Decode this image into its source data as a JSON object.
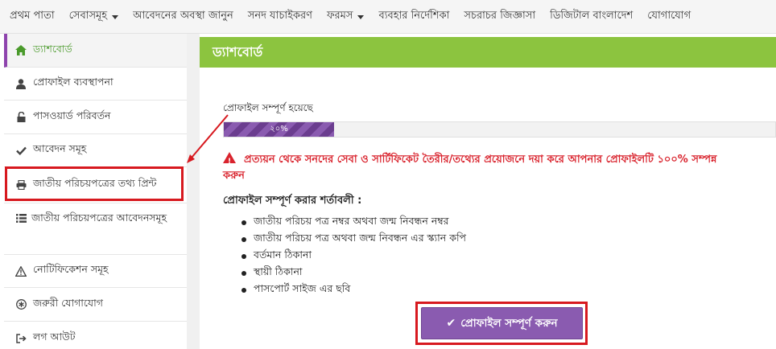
{
  "topnav": {
    "items": [
      {
        "label": "প্রথম পাতা",
        "dropdown": false
      },
      {
        "label": "সেবাসমূহ",
        "dropdown": true
      },
      {
        "label": "আবেদনের অবস্থা জানুন",
        "dropdown": false
      },
      {
        "label": "সনদ যাচাইকরণ",
        "dropdown": false
      },
      {
        "label": "ফরমস",
        "dropdown": true
      },
      {
        "label": "ব্যবহার নির্দেশিকা",
        "dropdown": false
      },
      {
        "label": "সচরাচর জিজ্ঞাসা",
        "dropdown": false
      },
      {
        "label": "ডিজিটাল বাংলাদেশ",
        "dropdown": false
      },
      {
        "label": "যোগাযোগ",
        "dropdown": false
      }
    ]
  },
  "sidebar": {
    "items": [
      {
        "label": "ড্যাশবোর্ড",
        "icon": "home-icon"
      },
      {
        "label": "প্রোফাইল ব্যবস্থাপনা",
        "icon": "user-icon"
      },
      {
        "label": "পাসওয়ার্ড পরিবর্তন",
        "icon": "lock-icon"
      },
      {
        "label": "আবেদন সমূহ",
        "icon": "check-icon"
      },
      {
        "label": "জাতীয় পরিচয়পত্রের তথ্য প্রিন্ট",
        "icon": "print-icon"
      },
      {
        "label": "জাতীয় পরিচয়পত্রের আবেদনসমূহ",
        "icon": "list-icon"
      },
      {
        "label": "নোটিফিকেশন সমূহ",
        "icon": "warning-icon"
      },
      {
        "label": "জরুরী যোগাযোগ",
        "icon": "asterisk-icon"
      },
      {
        "label": "লগ আউট",
        "icon": "logout-icon"
      }
    ]
  },
  "main": {
    "header": "ড্যাশবোর্ড",
    "progress": {
      "label": "প্রোফাইল সম্পূর্ণ হয়েছে",
      "percent": 20,
      "text": "২০%"
    },
    "warning": {
      "line1": "প্রত্যয়ন থেকে সনদের সেবা ও সার্টিফিকেট তৈরীর/তথ্যের প্রয়োজনে দয়া করে আপনার প্রোফাইলটি ১০০% সম্পন্ন",
      "line2": "করুন"
    },
    "conditions_title": "প্রোফাইল সম্পূর্ণ করার শর্তাবলী :",
    "conditions": [
      "জাতীয় পরিচয় পত্র নম্বর অথবা জন্ম নিবন্ধন নম্বর",
      "জাতীয় পরিচয় পত্র অথবা জন্ম নিবন্ধন এর স্ক্যান কপি",
      "বর্তমান ঠিকানা",
      "স্থায়ী ঠিকানা",
      "পাসপোর্ট সাইজ এর ছবি"
    ],
    "button_label": "প্রোফাইল সম্পূর্ণ করুন"
  },
  "colors": {
    "header_green": "#8cc43f",
    "purple": "#8a5bb0",
    "warning_red": "#d9232d",
    "highlight_red": "#d7191f"
  }
}
